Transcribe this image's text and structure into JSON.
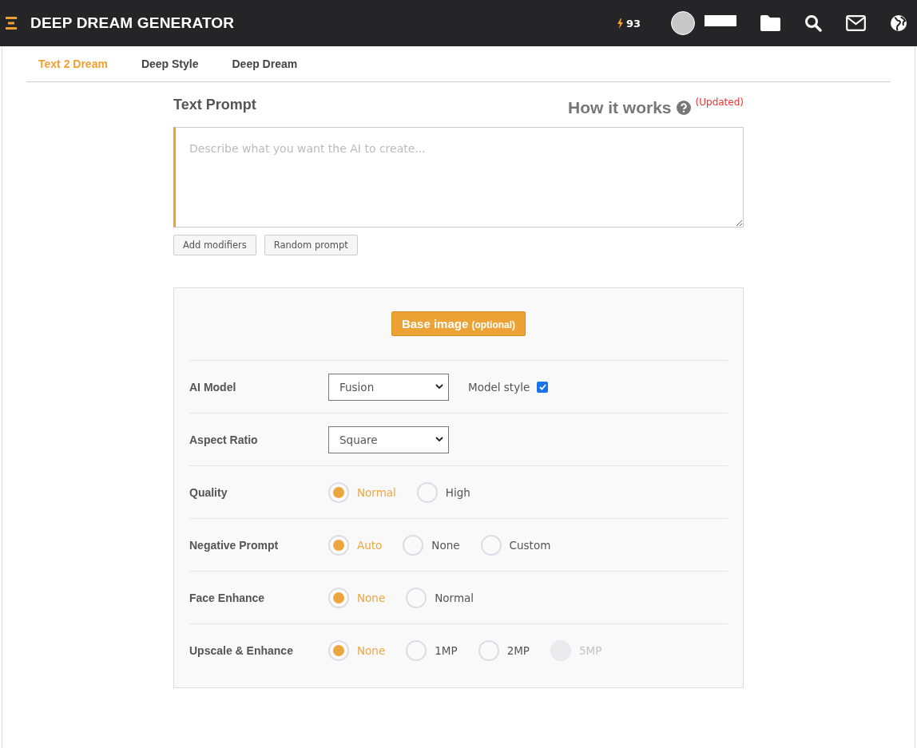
{
  "header": {
    "title": "DEEP DREAM GENERATOR",
    "energy": "93"
  },
  "tabs": [
    {
      "label": "Text 2 Dream",
      "selected": true
    },
    {
      "label": "Deep Style",
      "selected": false
    },
    {
      "label": "Deep Dream",
      "selected": false
    }
  ],
  "prompt": {
    "title": "Text Prompt",
    "help_link": "How it works",
    "updated_note": "(Updated)",
    "placeholder": "Describe what you want the AI to create...",
    "buttons": [
      "Add modifiers",
      "Random prompt"
    ]
  },
  "settings": {
    "base_image_button": {
      "label": "Base image",
      "note": "(optional)"
    },
    "rows": [
      {
        "kind": "select",
        "label": "AI Model",
        "value": "Fusion",
        "checkbox": {
          "label": "Model style",
          "checked": true
        }
      },
      {
        "kind": "select",
        "label": "Aspect Ratio",
        "value": "Square"
      },
      {
        "kind": "radio",
        "label": "Quality",
        "options": [
          {
            "label": "Normal",
            "selected": true,
            "disabled": false
          },
          {
            "label": "High",
            "selected": false,
            "disabled": false
          }
        ]
      },
      {
        "kind": "radio",
        "label": "Negative Prompt",
        "options": [
          {
            "label": "Auto",
            "selected": true,
            "disabled": false
          },
          {
            "label": "None",
            "selected": false,
            "disabled": false
          },
          {
            "label": "Custom",
            "selected": false,
            "disabled": false
          }
        ]
      },
      {
        "kind": "radio",
        "label": "Face Enhance",
        "options": [
          {
            "label": "None",
            "selected": true,
            "disabled": false
          },
          {
            "label": "Normal",
            "selected": false,
            "disabled": false
          }
        ]
      },
      {
        "kind": "radio",
        "label": "Upscale & Enhance",
        "options": [
          {
            "label": "None",
            "selected": true,
            "disabled": false
          },
          {
            "label": "1MP",
            "selected": false,
            "disabled": false
          },
          {
            "label": "2MP",
            "selected": false,
            "disabled": false
          },
          {
            "label": "5MP",
            "selected": false,
            "disabled": true
          }
        ]
      }
    ]
  }
}
